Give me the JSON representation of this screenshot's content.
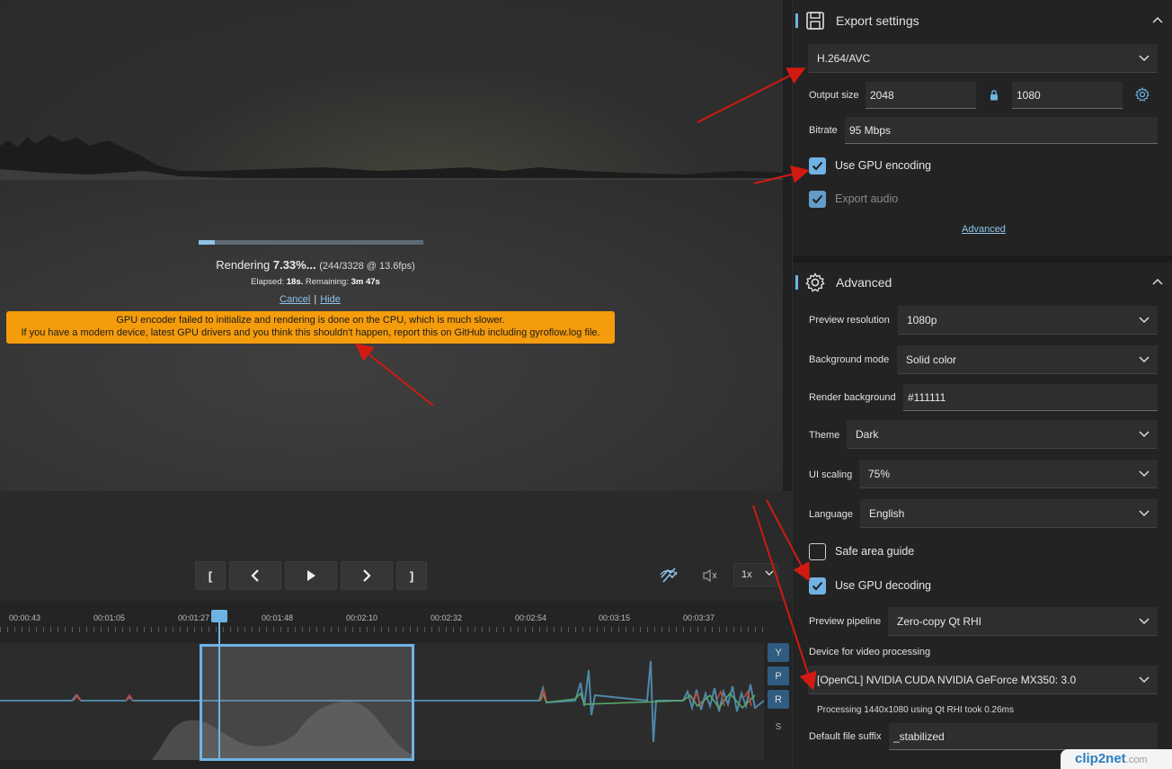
{
  "render": {
    "label": "Rendering",
    "percent": "7.33%...",
    "frames": "(244/3328 @ 13.6fps)",
    "progress": 0.0733,
    "elapsed_label": "Elapsed:",
    "elapsed_value": "18s.",
    "remaining_label": "Remaining:",
    "remaining_value": "3m 47s",
    "cancel": "Cancel",
    "separator": "|",
    "hide": "Hide",
    "warning_line1": "GPU encoder failed to initialize and rendering is done on the CPU, which is much slower.",
    "warning_line2": "If you have a modern device, latest GPU drivers and you think this shouldn't happen, report this on GitHub including gyroflow.log file."
  },
  "controls": {
    "set_start": "[",
    "prev_frame": "<",
    "next_frame": ">",
    "set_end": "]",
    "speed": "1x"
  },
  "timeline": {
    "ticks": [
      "00:00:43",
      "00:01:05",
      "00:01:27",
      "00:01:48",
      "00:02:10",
      "00:02:32",
      "00:02:54",
      "00:03:15",
      "00:03:37"
    ],
    "axes": [
      "Y",
      "P",
      "R"
    ],
    "s_label": "S"
  },
  "export_settings": {
    "title": "Export settings",
    "codec": "H.264/AVC",
    "output_size_label": "Output size",
    "width": "2048",
    "height": "1080",
    "bitrate_label": "Bitrate",
    "bitrate": "95 Mbps",
    "use_gpu_encoding": "Use GPU encoding",
    "export_audio": "Export audio",
    "advanced_link": "Advanced"
  },
  "advanced": {
    "title": "Advanced",
    "preview_resolution_label": "Preview resolution",
    "preview_resolution": "1080p",
    "background_mode_label": "Background mode",
    "background_mode": "Solid color",
    "render_background_label": "Render background",
    "render_background": "#111111",
    "theme_label": "Theme",
    "theme": "Dark",
    "ui_scaling_label": "UI scaling",
    "ui_scaling": "75%",
    "language_label": "Language",
    "language": "English",
    "safe_area_guide": "Safe area guide",
    "use_gpu_decoding": "Use GPU decoding",
    "preview_pipeline_label": "Preview pipeline",
    "preview_pipeline": "Zero-copy Qt RHI",
    "device_label": "Device for video processing",
    "device": "[OpenCL] NVIDIA CUDA NVIDIA GeForce MX350: 3.0",
    "processing_info": "Processing 1440x1080 using Qt RHI took 0.26ms",
    "default_suffix_label": "Default file suffix",
    "default_suffix": "_stabilized"
  },
  "watermark": {
    "brand": "clip2net",
    "tld": ".com"
  },
  "colors": {
    "accent": "#6fb3e4",
    "warning": "#f59c0c",
    "arrow": "#d01a12"
  }
}
